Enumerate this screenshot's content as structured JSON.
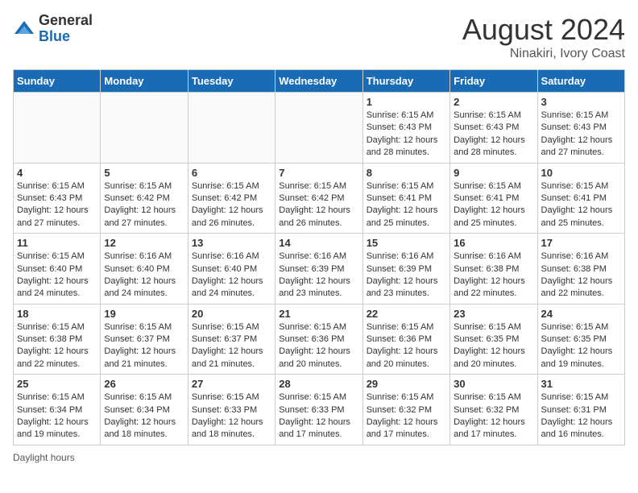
{
  "header": {
    "logo_general": "General",
    "logo_blue": "Blue",
    "title": "August 2024",
    "subtitle": "Ninakiri, Ivory Coast"
  },
  "days_of_week": [
    "Sunday",
    "Monday",
    "Tuesday",
    "Wednesday",
    "Thursday",
    "Friday",
    "Saturday"
  ],
  "weeks": [
    [
      {
        "day": "",
        "info": ""
      },
      {
        "day": "",
        "info": ""
      },
      {
        "day": "",
        "info": ""
      },
      {
        "day": "",
        "info": ""
      },
      {
        "day": "1",
        "info": "Sunrise: 6:15 AM\nSunset: 6:43 PM\nDaylight: 12 hours and 28 minutes."
      },
      {
        "day": "2",
        "info": "Sunrise: 6:15 AM\nSunset: 6:43 PM\nDaylight: 12 hours and 28 minutes."
      },
      {
        "day": "3",
        "info": "Sunrise: 6:15 AM\nSunset: 6:43 PM\nDaylight: 12 hours and 27 minutes."
      }
    ],
    [
      {
        "day": "4",
        "info": "Sunrise: 6:15 AM\nSunset: 6:43 PM\nDaylight: 12 hours and 27 minutes."
      },
      {
        "day": "5",
        "info": "Sunrise: 6:15 AM\nSunset: 6:42 PM\nDaylight: 12 hours and 27 minutes."
      },
      {
        "day": "6",
        "info": "Sunrise: 6:15 AM\nSunset: 6:42 PM\nDaylight: 12 hours and 26 minutes."
      },
      {
        "day": "7",
        "info": "Sunrise: 6:15 AM\nSunset: 6:42 PM\nDaylight: 12 hours and 26 minutes."
      },
      {
        "day": "8",
        "info": "Sunrise: 6:15 AM\nSunset: 6:41 PM\nDaylight: 12 hours and 25 minutes."
      },
      {
        "day": "9",
        "info": "Sunrise: 6:15 AM\nSunset: 6:41 PM\nDaylight: 12 hours and 25 minutes."
      },
      {
        "day": "10",
        "info": "Sunrise: 6:15 AM\nSunset: 6:41 PM\nDaylight: 12 hours and 25 minutes."
      }
    ],
    [
      {
        "day": "11",
        "info": "Sunrise: 6:15 AM\nSunset: 6:40 PM\nDaylight: 12 hours and 24 minutes."
      },
      {
        "day": "12",
        "info": "Sunrise: 6:16 AM\nSunset: 6:40 PM\nDaylight: 12 hours and 24 minutes."
      },
      {
        "day": "13",
        "info": "Sunrise: 6:16 AM\nSunset: 6:40 PM\nDaylight: 12 hours and 24 minutes."
      },
      {
        "day": "14",
        "info": "Sunrise: 6:16 AM\nSunset: 6:39 PM\nDaylight: 12 hours and 23 minutes."
      },
      {
        "day": "15",
        "info": "Sunrise: 6:16 AM\nSunset: 6:39 PM\nDaylight: 12 hours and 23 minutes."
      },
      {
        "day": "16",
        "info": "Sunrise: 6:16 AM\nSunset: 6:38 PM\nDaylight: 12 hours and 22 minutes."
      },
      {
        "day": "17",
        "info": "Sunrise: 6:16 AM\nSunset: 6:38 PM\nDaylight: 12 hours and 22 minutes."
      }
    ],
    [
      {
        "day": "18",
        "info": "Sunrise: 6:15 AM\nSunset: 6:38 PM\nDaylight: 12 hours and 22 minutes."
      },
      {
        "day": "19",
        "info": "Sunrise: 6:15 AM\nSunset: 6:37 PM\nDaylight: 12 hours and 21 minutes."
      },
      {
        "day": "20",
        "info": "Sunrise: 6:15 AM\nSunset: 6:37 PM\nDaylight: 12 hours and 21 minutes."
      },
      {
        "day": "21",
        "info": "Sunrise: 6:15 AM\nSunset: 6:36 PM\nDaylight: 12 hours and 20 minutes."
      },
      {
        "day": "22",
        "info": "Sunrise: 6:15 AM\nSunset: 6:36 PM\nDaylight: 12 hours and 20 minutes."
      },
      {
        "day": "23",
        "info": "Sunrise: 6:15 AM\nSunset: 6:35 PM\nDaylight: 12 hours and 20 minutes."
      },
      {
        "day": "24",
        "info": "Sunrise: 6:15 AM\nSunset: 6:35 PM\nDaylight: 12 hours and 19 minutes."
      }
    ],
    [
      {
        "day": "25",
        "info": "Sunrise: 6:15 AM\nSunset: 6:34 PM\nDaylight: 12 hours and 19 minutes."
      },
      {
        "day": "26",
        "info": "Sunrise: 6:15 AM\nSunset: 6:34 PM\nDaylight: 12 hours and 18 minutes."
      },
      {
        "day": "27",
        "info": "Sunrise: 6:15 AM\nSunset: 6:33 PM\nDaylight: 12 hours and 18 minutes."
      },
      {
        "day": "28",
        "info": "Sunrise: 6:15 AM\nSunset: 6:33 PM\nDaylight: 12 hours and 17 minutes."
      },
      {
        "day": "29",
        "info": "Sunrise: 6:15 AM\nSunset: 6:32 PM\nDaylight: 12 hours and 17 minutes."
      },
      {
        "day": "30",
        "info": "Sunrise: 6:15 AM\nSunset: 6:32 PM\nDaylight: 12 hours and 17 minutes."
      },
      {
        "day": "31",
        "info": "Sunrise: 6:15 AM\nSunset: 6:31 PM\nDaylight: 12 hours and 16 minutes."
      }
    ]
  ],
  "footer": {
    "daylight_label": "Daylight hours"
  }
}
